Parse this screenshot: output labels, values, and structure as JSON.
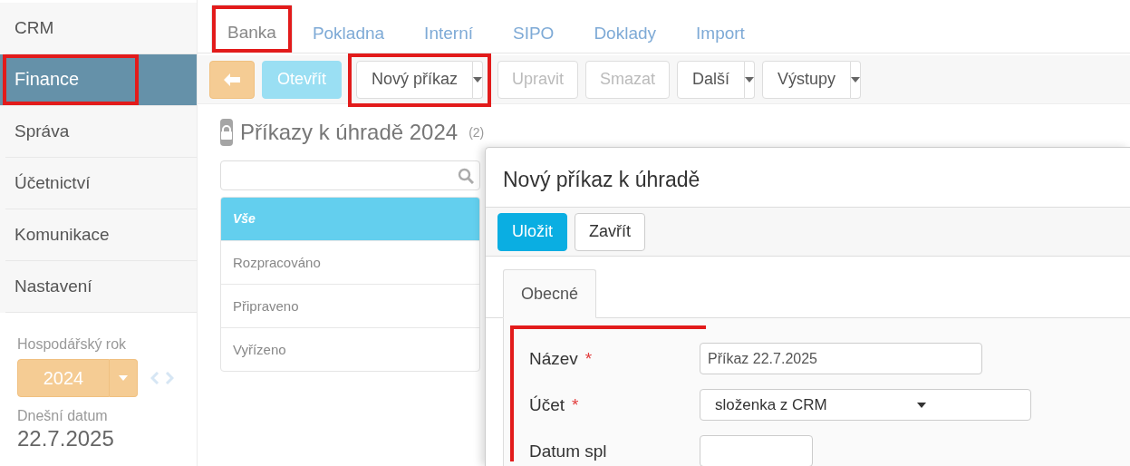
{
  "sidebar": {
    "items": [
      {
        "label": "CRM",
        "selected": false
      },
      {
        "label": "Finance",
        "selected": true,
        "highlighted": true
      },
      {
        "label": "Správa",
        "selected": false
      },
      {
        "label": "Účetnictví",
        "selected": false
      },
      {
        "label": "Komunikace",
        "selected": false
      },
      {
        "label": "Nastavení",
        "selected": false
      }
    ],
    "fiscal_year": {
      "label": "Hospodářský rok",
      "value": "2024"
    },
    "today": {
      "label": "Dnešní datum",
      "value": "22.7.2025"
    }
  },
  "tabs": [
    {
      "label": "Banka",
      "selected": true,
      "highlighted": true
    },
    {
      "label": "Pokladna",
      "selected": false
    },
    {
      "label": "Interní",
      "selected": false
    },
    {
      "label": "SIPO",
      "selected": false
    },
    {
      "label": "Doklady",
      "selected": false
    },
    {
      "label": "Import",
      "selected": false
    }
  ],
  "toolbar": [
    {
      "kind": "back"
    },
    {
      "kind": "info",
      "label": "Otevřít",
      "disabled": true
    },
    {
      "kind": "split",
      "label": "Nový příkaz",
      "disabled": false,
      "highlighted": true
    },
    {
      "kind": "button",
      "label": "Upravit",
      "disabled": true
    },
    {
      "kind": "button",
      "label": "Smazat",
      "disabled": true
    },
    {
      "kind": "split",
      "label": "Další",
      "disabled": false
    },
    {
      "kind": "split",
      "label": "Výstupy",
      "disabled": false
    }
  ],
  "list": {
    "title": "Příkazy k úhradě 2024",
    "count": "(2)",
    "filters": [
      {
        "label": "Vše",
        "selected": true
      },
      {
        "label": "Rozpracováno",
        "selected": false
      },
      {
        "label": "Připraveno",
        "selected": false
      },
      {
        "label": "Vyřízeno",
        "selected": false
      }
    ]
  },
  "dialog": {
    "title": "Nový příkaz k úhradě",
    "buttons": [
      {
        "label": "Uložit",
        "kind": "primary"
      },
      {
        "label": "Zavřít",
        "kind": "default"
      }
    ],
    "tabs": [
      {
        "label": "Obecné",
        "selected": true
      }
    ],
    "highlighted": true,
    "fields": [
      {
        "label": "Název",
        "required_mark": "*",
        "kind": "text",
        "value": "Příkaz 22.7.2025"
      },
      {
        "label": "Účet",
        "required_mark": "*",
        "kind": "select",
        "value": "složenka z CRM"
      },
      {
        "label": "Datum spl",
        "kind": "date"
      }
    ]
  }
}
